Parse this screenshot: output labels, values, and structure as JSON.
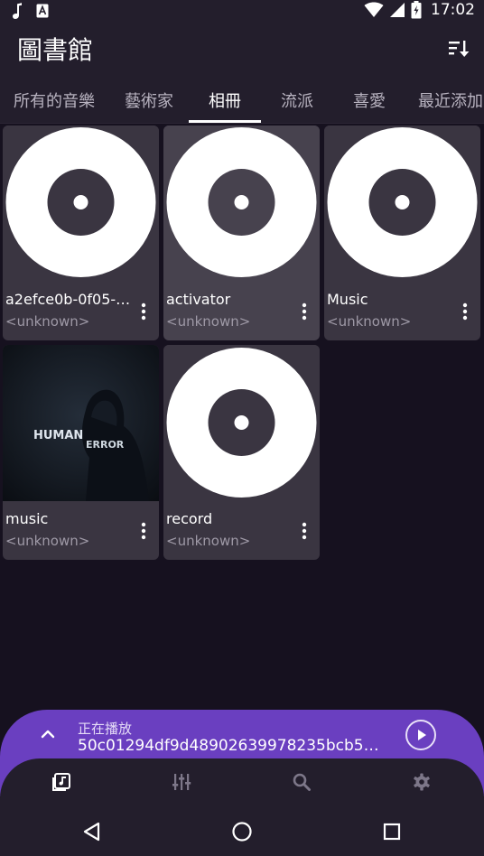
{
  "status_bar": {
    "time": "17:02",
    "icons": [
      "music-note-icon",
      "text-box-a-icon",
      "wifi-icon",
      "signal-icon",
      "battery-icon"
    ]
  },
  "app_bar": {
    "title": "圖書館",
    "sort_icon": "sort-descending-icon"
  },
  "tabs": [
    {
      "label": "所有的音樂"
    },
    {
      "label": "藝術家"
    },
    {
      "label": "相冊",
      "active": true
    },
    {
      "label": "流派"
    },
    {
      "label": "喜愛"
    },
    {
      "label": "最近添加"
    }
  ],
  "albums": [
    {
      "title": "a2efce0b-0f05-4…",
      "subtitle": "<unknown>",
      "art": "vinyl-placeholder"
    },
    {
      "title": "activator",
      "subtitle": "<unknown>",
      "art": "vinyl-placeholder",
      "selected": true
    },
    {
      "title": "Music",
      "subtitle": "<unknown>",
      "art": "vinyl-placeholder"
    },
    {
      "title": "music",
      "subtitle": "<unknown>",
      "art": "photo-human-error",
      "art_text": [
        "HUMAN",
        "ERROR"
      ]
    },
    {
      "title": "record",
      "subtitle": "<unknown>",
      "art": "vinyl-placeholder"
    }
  ],
  "mini_player": {
    "label": "正在播放",
    "track": "50c01294df9d48902639978235bcb5…"
  },
  "bottom_nav": [
    {
      "icon": "library-music-icon",
      "active": true
    },
    {
      "icon": "equalizer-icon"
    },
    {
      "icon": "search-icon"
    },
    {
      "icon": "settings-icon"
    }
  ],
  "colors": {
    "background": "#16111f",
    "surface": "#231e2c",
    "card": "#3a3541",
    "accent": "#6a3fc0"
  }
}
